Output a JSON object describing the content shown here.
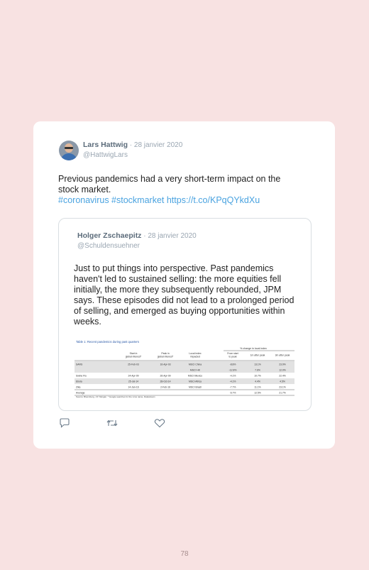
{
  "tweet": {
    "author_name": "Lars Hattwig",
    "separator": " · ",
    "date": "28 janvier 2020",
    "handle": "@HattwigLars",
    "text_line1": "Previous pandemics had a very short-term impact on the",
    "text_line2": "stock market.",
    "link_text": "#coronavirus #stockmarket https://t.co/KPqQYkdXu",
    "link_color": "#4aa3e0"
  },
  "quoted": {
    "author_name": "Holger Zschaepitz",
    "separator": " · ",
    "date": "28 janvier 2020",
    "handle": "@Schuldensuehner",
    "text": "Just to put things into perspective. Past pandemics haven't led to sustained selling: the more equities fell initially, the more they subsequently rebounded, JPM says. These episodes did not lead to a prolonged period of selling, and emerged as buying opportunities within weeks.",
    "table": {
      "caption": "Table 1: Recent pandemics during past quarters",
      "group_header": "% change in local index",
      "columns": [
        "",
        "Start in global interest*",
        "Peak in global interest*",
        "Local index impacted",
        "From start to peak",
        "1m after peak",
        "3m after peak"
      ],
      "rows": [
        [
          "SARS",
          "25-Feb-03",
          "16-Apr-03",
          "MSCI China",
          "-8.8%",
          "13.1%",
          "23.9%"
        ],
        [
          "",
          "",
          "",
          "MSCI HK",
          "-12.8%",
          "7.6%",
          "12.0%"
        ],
        [
          "Swine Flu",
          "24-Apr-09",
          "26-Apr-09",
          "MSCI Mexico",
          "-4.1%",
          "10.7%",
          "22.4%"
        ],
        [
          "Ebola",
          "25-Jul-14",
          "28-Oct-14",
          "MSCI Africa",
          "-4.1%",
          "4.4%",
          "4.5%"
        ],
        [
          "Zika",
          "14-Jan-16",
          "2-Feb-16",
          "MSCI Brazil",
          "-7.7%",
          "11.1%",
          "23.1%"
        ],
        [
          "Average",
          "",
          "",
          "",
          "-6.7%",
          "12.5%",
          "21.7%"
        ]
      ],
      "source": "Source: Bloomberg, J.P. Morgan. * Google searches for the virus name, Datastream"
    }
  },
  "actions": {
    "reply_icon": "reply-icon",
    "retweet_icon": "retweet-icon",
    "like_icon": "heart-icon"
  },
  "page_number": "78"
}
